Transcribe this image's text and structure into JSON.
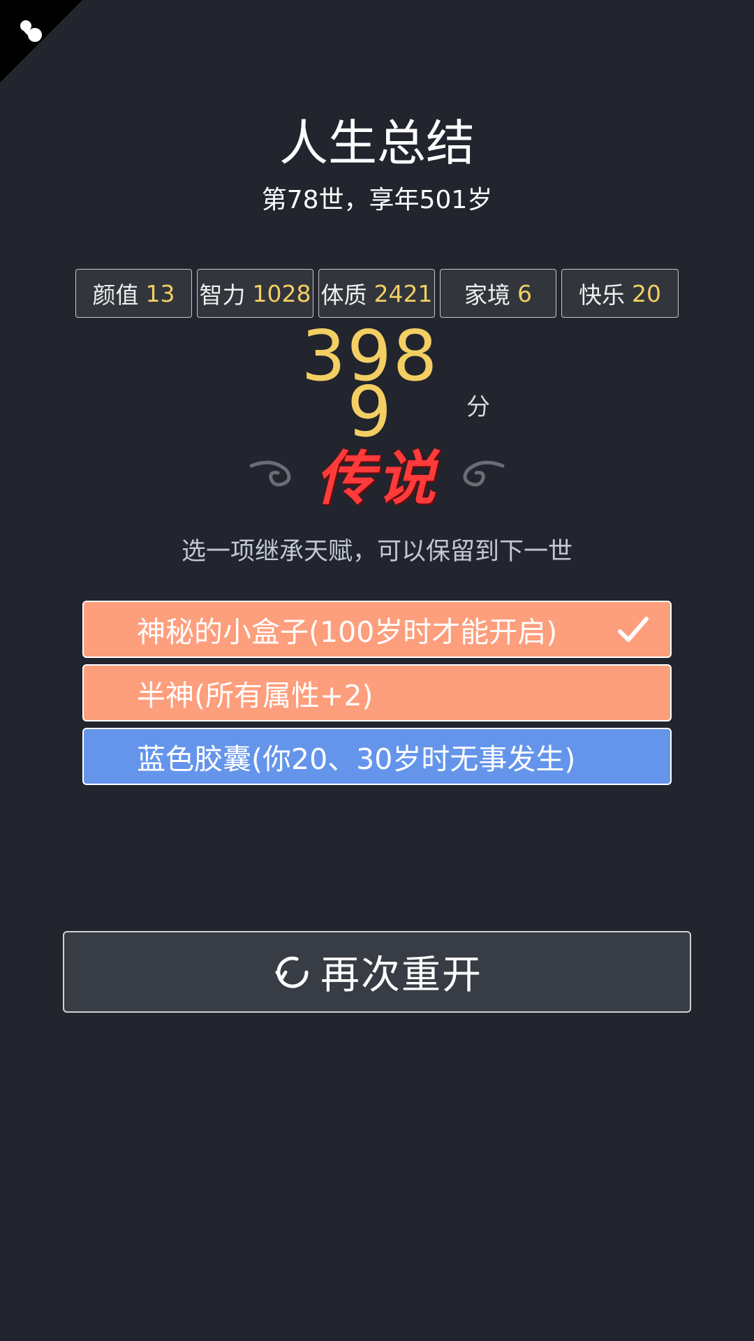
{
  "corner": {
    "icon": "pawn-icon"
  },
  "title": "人生总结",
  "subtitle": "第78世，享年501岁",
  "stats": [
    {
      "label": "颜值",
      "value": "13"
    },
    {
      "label": "智力",
      "value": "1028"
    },
    {
      "label": "体质",
      "value": "2421"
    },
    {
      "label": "家境",
      "value": "6"
    },
    {
      "label": "快乐",
      "value": "20"
    }
  ],
  "score": {
    "value": "3989",
    "unit": "分"
  },
  "grade": "传说",
  "hint": "选一项继承天赋，可以保留到下一世",
  "options": [
    {
      "label": "神秘的小盒子(100岁时才能开启)",
      "color": "#fd9e7c",
      "selected": true
    },
    {
      "label": "半神(所有属性+2)",
      "color": "#fd9e7c",
      "selected": false
    },
    {
      "label": "蓝色胶囊(你20、30岁时无事发生)",
      "color": "#6495eb",
      "selected": false
    }
  ],
  "restart": {
    "label": "再次重开",
    "icon": "refresh-icon"
  },
  "colors": {
    "background": "#22252e",
    "accent_value": "#f3cf63",
    "grade_red": "#ff3b3b"
  }
}
